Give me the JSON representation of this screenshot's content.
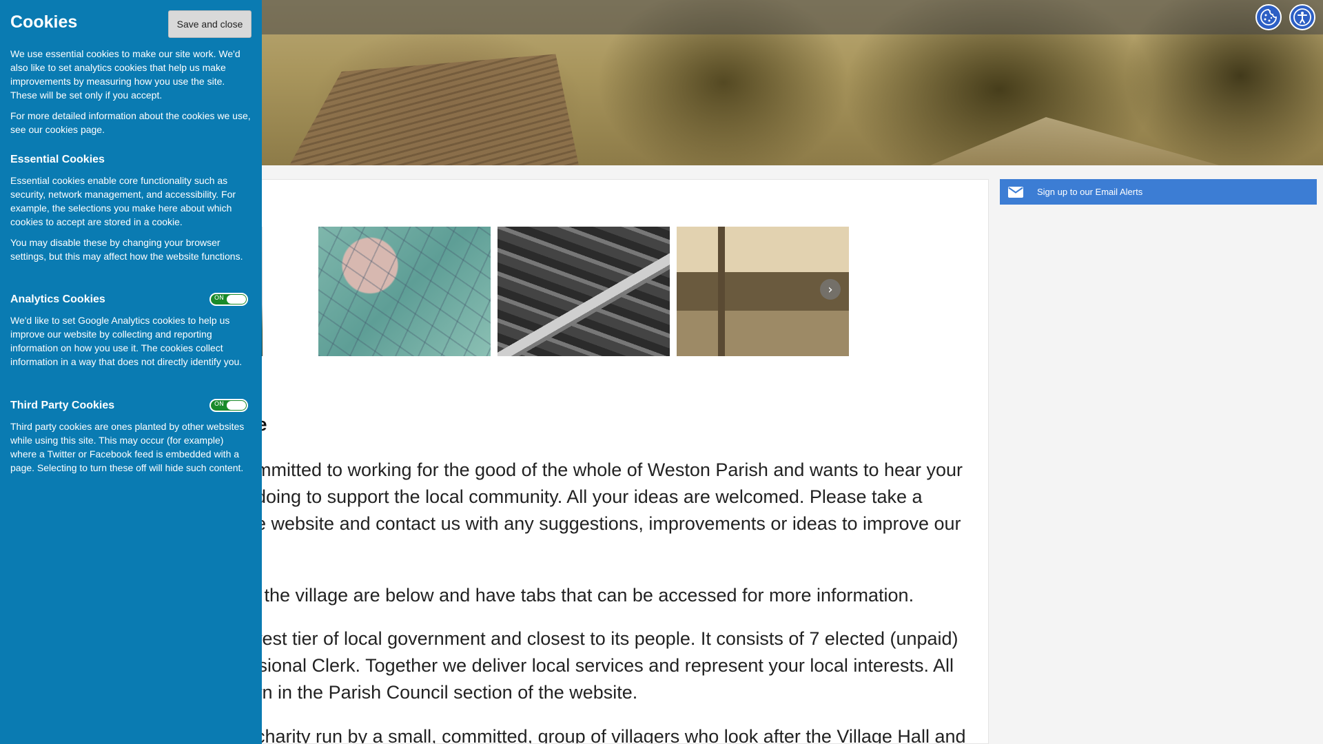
{
  "cookie_panel": {
    "title": "Cookies",
    "save_button": "Save and close",
    "intro": "We use essential cookies to make our site work. We'd also like to set analytics cookies that help us make improvements by measuring how you use the site. These will be set only if you accept.",
    "more_info": "For more detailed information about the cookies we use, see our cookies page.",
    "essential": {
      "heading": "Essential Cookies",
      "text1": "Essential cookies enable core functionality such as security, network management, and accessibility. For example, the selections you make here about which cookies to accept are stored in a cookie.",
      "text2": "You may disable these by changing your browser settings, but this may affect how the website functions."
    },
    "analytics": {
      "heading": "Analytics Cookies",
      "toggle_label": "ON",
      "text": "We'd like to set Google Analytics cookies to help us improve our website by collecting and reporting information on how you use it. The cookies collect information in a way that does not directly identify you."
    },
    "third_party": {
      "heading": "Third Party Cookies",
      "toggle_label": "ON",
      "text": "Third party cookies are ones planted by other websites while using this site. This may occur (for example) where a Twitter or Facebook feed is embedded with a page. Selecting to turn these off will hide such content."
    }
  },
  "header": {
    "icons": [
      "cookie-settings-icon",
      "accessibility-icon"
    ],
    "accent_color": "#2d5fc4"
  },
  "sidebar": {
    "email_alert_label": "Sign up to our Email Alerts",
    "color": "#3c7dd4"
  },
  "main": {
    "heading_fragment": "site",
    "paragraphs": [
      "mmitted to working for the good of the whole of Weston Parish and wants to hear your\ndoing to support the local community. All your ideas are welcomed. Please take a\ne website and contact us with any suggestions, improvements or ideas to improve our",
      "n the village are below and have tabs that can be accessed for more information.",
      "west tier of local government and closest to its people. It consists of 7 elected (unpaid)\nssional Clerk. Together we deliver local services and represent your local interests. All\nwn in the Parish Council section of the website.",
      "charity run by a small, committed, group of villagers who look after the Village Hall and"
    ]
  },
  "colors": {
    "cookie_panel_bg": "#0a7bb2",
    "toggle_on": "#1a8a2a"
  }
}
